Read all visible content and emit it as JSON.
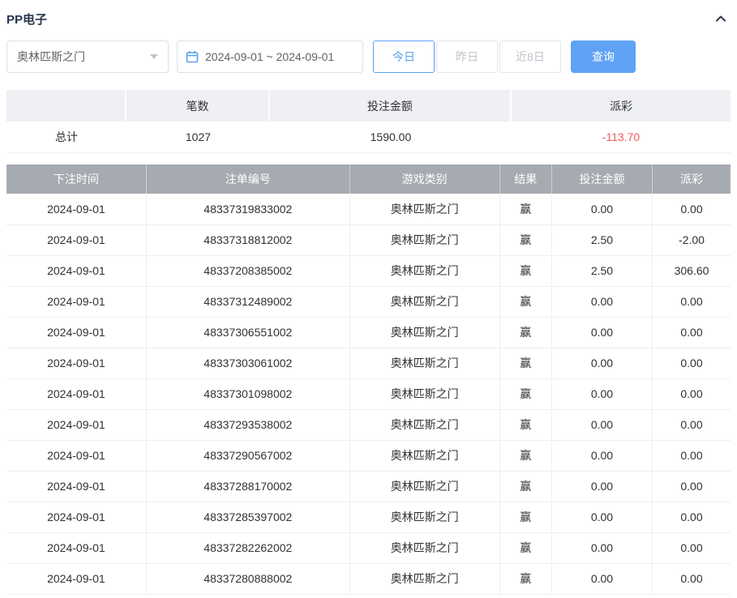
{
  "header": {
    "title": "PP电子"
  },
  "filters": {
    "game_select": {
      "value": "奥林匹斯之门"
    },
    "date_range": {
      "value": "2024-09-01 ~ 2024-09-01"
    },
    "quick_buttons": [
      {
        "label": "今日",
        "active": true
      },
      {
        "label": "昨日",
        "active": false
      },
      {
        "label": "近8日",
        "active": false
      }
    ],
    "query_button": "查询"
  },
  "summary": {
    "headers": [
      "",
      "笔数",
      "投注金额",
      "派彩"
    ],
    "row_label": "总计",
    "count": "1027",
    "bet_amount": "1590.00",
    "payout": "-113.70"
  },
  "table": {
    "headers": [
      "下注时间",
      "注单编号",
      "游戏类别",
      "结果",
      "投注金额",
      "派彩"
    ],
    "rows": [
      [
        "2024-09-01",
        "48337319833002",
        "奥林匹斯之门",
        "赢",
        "0.00",
        "0.00"
      ],
      [
        "2024-09-01",
        "48337318812002",
        "奥林匹斯之门",
        "赢",
        "2.50",
        "-2.00"
      ],
      [
        "2024-09-01",
        "48337208385002",
        "奥林匹斯之门",
        "赢",
        "2.50",
        "306.60"
      ],
      [
        "2024-09-01",
        "48337312489002",
        "奥林匹斯之门",
        "赢",
        "0.00",
        "0.00"
      ],
      [
        "2024-09-01",
        "48337306551002",
        "奥林匹斯之门",
        "赢",
        "0.00",
        "0.00"
      ],
      [
        "2024-09-01",
        "48337303061002",
        "奥林匹斯之门",
        "赢",
        "0.00",
        "0.00"
      ],
      [
        "2024-09-01",
        "48337301098002",
        "奥林匹斯之门",
        "赢",
        "0.00",
        "0.00"
      ],
      [
        "2024-09-01",
        "48337293538002",
        "奥林匹斯之门",
        "赢",
        "0.00",
        "0.00"
      ],
      [
        "2024-09-01",
        "48337290567002",
        "奥林匹斯之门",
        "赢",
        "0.00",
        "0.00"
      ],
      [
        "2024-09-01",
        "48337288170002",
        "奥林匹斯之门",
        "赢",
        "0.00",
        "0.00"
      ],
      [
        "2024-09-01",
        "48337285397002",
        "奥林匹斯之门",
        "赢",
        "0.00",
        "0.00"
      ],
      [
        "2024-09-01",
        "48337282262002",
        "奥林匹斯之门",
        "赢",
        "0.00",
        "0.00"
      ],
      [
        "2024-09-01",
        "48337280888002",
        "奥林匹斯之门",
        "赢",
        "0.00",
        "0.00"
      ]
    ]
  },
  "icons": {
    "collapse": "chevron-up",
    "select_caret": "chevron-down",
    "date": "calendar"
  },
  "colors": {
    "accent": "#5b9ff0",
    "query_button_bg": "#60a2f5",
    "negative": "#f35b5b",
    "table_header_bg": "#a6aab1",
    "summary_header_bg": "#eef0f3"
  }
}
